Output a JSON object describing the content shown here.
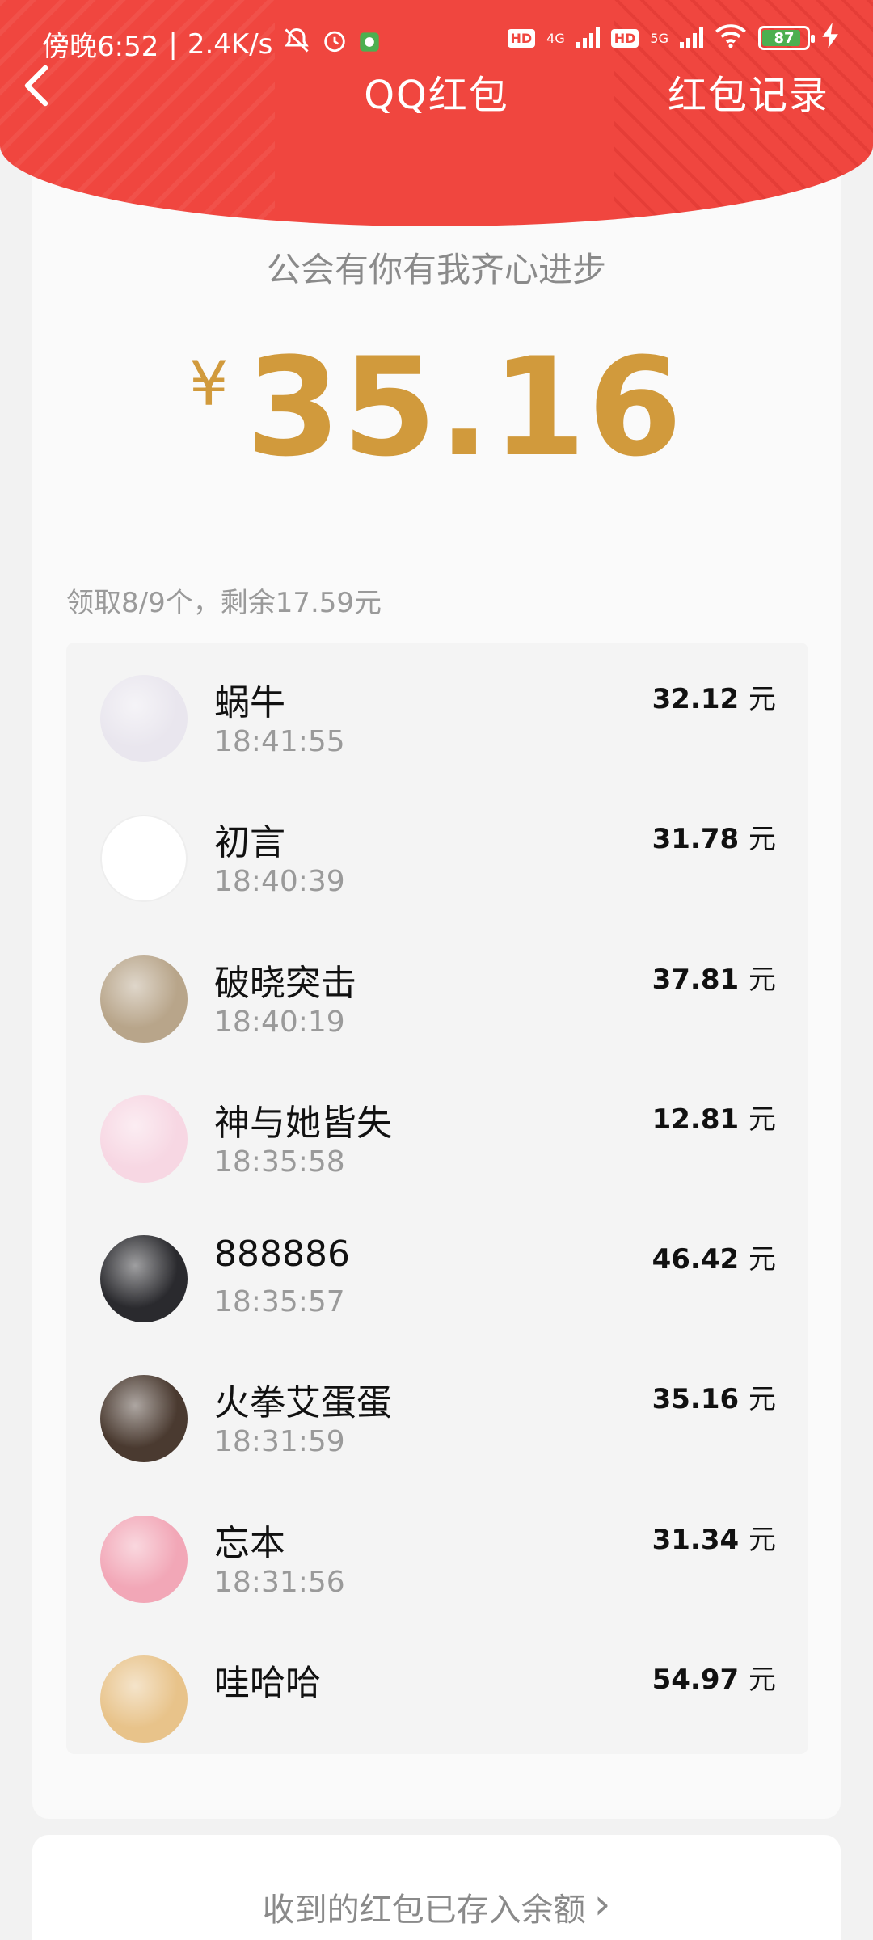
{
  "status": {
    "time_label": "傍晚6:52",
    "speed": "2.4K/s",
    "hd1": "HD",
    "net1": "4G",
    "hd2": "HD",
    "net2": "5G",
    "battery": "87",
    "battery_level": 0.87
  },
  "nav": {
    "title": "QQ红包",
    "records": "红包记录"
  },
  "packet": {
    "greeting": "公会有你有我齐心进步",
    "currency": "¥",
    "amount": "35.16",
    "summary": "领取8/9个，剩余17.59元"
  },
  "receivers": [
    {
      "name": "蜗牛",
      "time": "18:41:55",
      "amount": "32.12",
      "unit": "元",
      "avatar_color": "#e9e6ee"
    },
    {
      "name": "初言",
      "time": "18:40:39",
      "amount": "31.78",
      "unit": "元",
      "avatar_color": "#ffffff"
    },
    {
      "name": "破晓突击",
      "time": "18:40:19",
      "amount": "37.81",
      "unit": "元",
      "avatar_color": "#b8a58a"
    },
    {
      "name": "神与她皆失",
      "time": "18:35:58",
      "amount": "12.81",
      "unit": "元",
      "avatar_color": "#f7d7e3"
    },
    {
      "name": "888886",
      "time": "18:35:57",
      "amount": "46.42",
      "unit": "元",
      "avatar_color": "#2a2a2e"
    },
    {
      "name": "火拳艾蛋蛋",
      "time": "18:31:59",
      "amount": "35.16",
      "unit": "元",
      "avatar_color": "#4a3a30"
    },
    {
      "name": "忘本",
      "time": "18:31:56",
      "amount": "31.34",
      "unit": "元",
      "avatar_color": "#f2a7b7"
    },
    {
      "name": "哇哈哈",
      "time": "",
      "amount": "54.97",
      "unit": "元",
      "avatar_color": "#e8c38a"
    }
  ],
  "footer": {
    "text": "收到的红包已存入余额",
    "arrow": "›"
  },
  "colors": {
    "header_red": "#f0463f",
    "amount_gold": "#d19a3c"
  }
}
